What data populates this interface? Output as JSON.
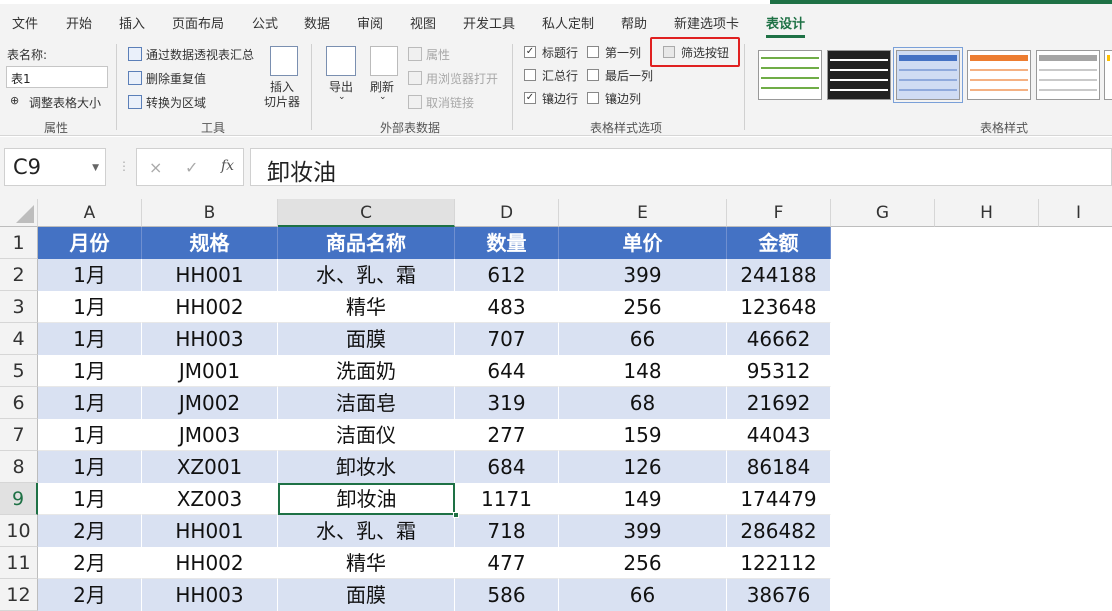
{
  "menu": {
    "tabs": [
      "文件",
      "开始",
      "插入",
      "页面布局",
      "公式",
      "数据",
      "审阅",
      "视图",
      "开发工具",
      "私人定制",
      "帮助",
      "新建选项卡",
      "表设计"
    ]
  },
  "ribbon": {
    "properties": {
      "table_name_label": "表名称:",
      "table_name_value": "表1",
      "resize_label": "调整表格大小",
      "group_label": "属性"
    },
    "tools": {
      "pivot_label": "通过数据透视表汇总",
      "remove_dup_label": "删除重复值",
      "convert_label": "转换为区域",
      "slicer_label_1": "插入",
      "slicer_label_2": "切片器",
      "group_label": "工具"
    },
    "external": {
      "export_label": "导出",
      "refresh_label": "刷新",
      "properties_label": "属性",
      "browser_label": "用浏览器打开",
      "unlink_label": "取消链接",
      "group_label": "外部表数据"
    },
    "style_options": {
      "header_row": {
        "label": "标题行",
        "checked": true
      },
      "total_row": {
        "label": "汇总行",
        "checked": false
      },
      "banded_rows": {
        "label": "镶边行",
        "checked": true
      },
      "first_col": {
        "label": "第一列",
        "checked": false
      },
      "last_col": {
        "label": "最后一列",
        "checked": false
      },
      "banded_cols": {
        "label": "镶边列",
        "checked": false
      },
      "filter_button": {
        "label": "筛选按钮",
        "checked": false
      },
      "group_label": "表格样式选项"
    },
    "styles": {
      "group_label": "表格样式"
    }
  },
  "formula_bar": {
    "name_box": "C9",
    "cancel_icon": "×",
    "enter_icon": "✓",
    "fx_icon": "fx",
    "content": "卸妆油"
  },
  "sheet": {
    "columns": [
      "A",
      "B",
      "C",
      "D",
      "E",
      "F",
      "G",
      "H",
      "I"
    ],
    "rows": [
      "1",
      "2",
      "3",
      "4",
      "5",
      "6",
      "7",
      "8",
      "9",
      "10",
      "11",
      "12"
    ],
    "header": [
      "月份",
      "规格",
      "商品名称",
      "数量",
      "单价",
      "金额"
    ],
    "data": [
      [
        "1月",
        "HH001",
        "水、乳、霜",
        "612",
        "399",
        "244188"
      ],
      [
        "1月",
        "HH002",
        "精华",
        "483",
        "256",
        "123648"
      ],
      [
        "1月",
        "HH003",
        "面膜",
        "707",
        "66",
        "46662"
      ],
      [
        "1月",
        "JM001",
        "洗面奶",
        "644",
        "148",
        "95312"
      ],
      [
        "1月",
        "JM002",
        "洁面皂",
        "319",
        "68",
        "21692"
      ],
      [
        "1月",
        "JM003",
        "洁面仪",
        "277",
        "159",
        "44043"
      ],
      [
        "1月",
        "XZ001",
        "卸妆水",
        "684",
        "126",
        "86184"
      ],
      [
        "1月",
        "XZ003",
        "卸妆油",
        "1171",
        "149",
        "174479"
      ],
      [
        "2月",
        "HH001",
        "水、乳、霜",
        "718",
        "399",
        "286482"
      ],
      [
        "2月",
        "HH002",
        "精华",
        "477",
        "256",
        "122112"
      ],
      [
        "2月",
        "HH003",
        "面膜",
        "586",
        "66",
        "38676"
      ]
    ],
    "active_cell": "C9"
  },
  "colors": {
    "accent": "#1e7145",
    "table_header": "#4472c4",
    "band": "#d9e1f2",
    "highlight": "#e02020"
  }
}
